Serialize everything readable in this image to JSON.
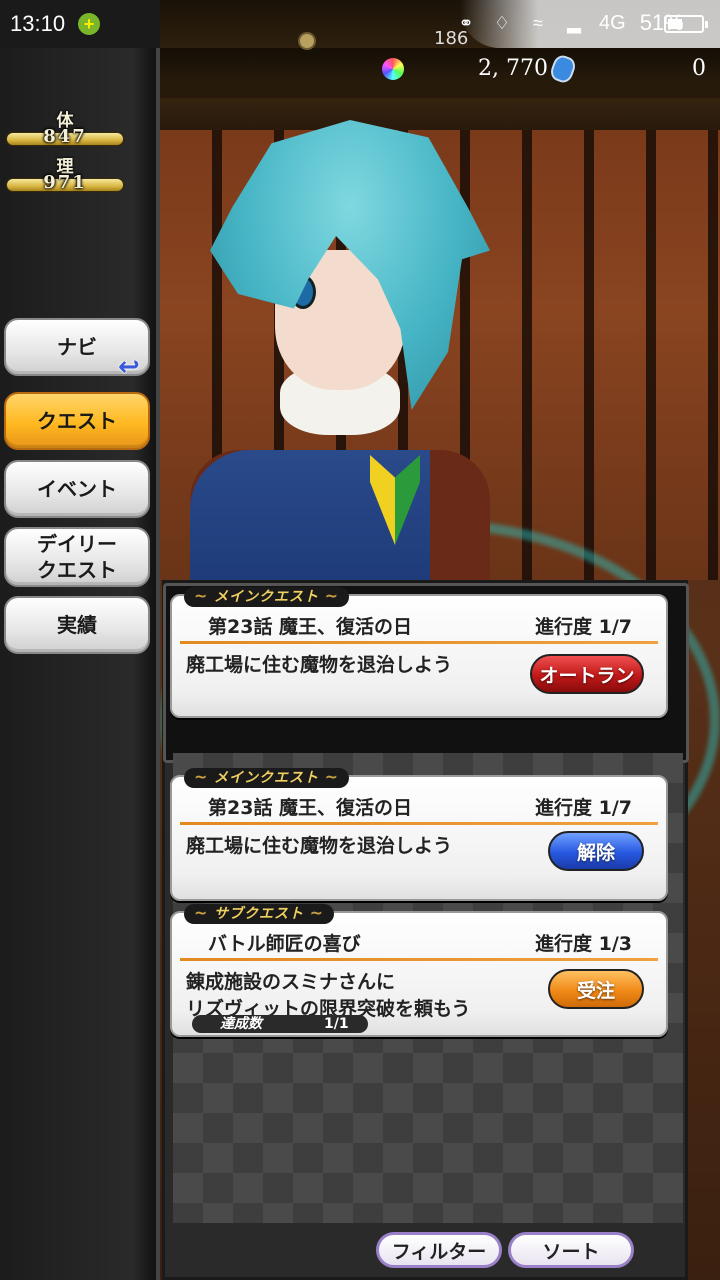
{
  "status_bar": {
    "time": "13:10",
    "network": "4G",
    "battery": "51%"
  },
  "resources": {
    "small_counter": "186",
    "gems": "2, 770",
    "crystals": "0"
  },
  "stats": [
    {
      "label": "体",
      "value": "847"
    },
    {
      "label": "理",
      "value": "971"
    }
  ],
  "nav": {
    "items": [
      {
        "label": "ナビ",
        "active": false
      },
      {
        "label": "クエスト",
        "active": true
      },
      {
        "label": "イベント",
        "active": false
      },
      {
        "label": "デイリー\nクエスト",
        "active": false
      },
      {
        "label": "実績",
        "active": false
      }
    ]
  },
  "quests": [
    {
      "tag": "メインクエスト",
      "title": "第23話  魔王、復活の日",
      "progress": "進行度  1/7",
      "description": "廃工場に住む魔物を退治しよう",
      "button": "オートラン"
    },
    {
      "tag": "メインクエスト",
      "title": "第23話  魔王、復活の日",
      "progress": "進行度  1/7",
      "description": "廃工場に住む魔物を退治しよう",
      "button": "解除"
    },
    {
      "tag": "サブクエスト",
      "title": "バトル師匠の喜び",
      "progress": "進行度  1/3",
      "description_line1": "錬成施設のスミナさんに",
      "description_line2": "リズヴィットの限界突破を頼もう",
      "button": "受注",
      "achievement_label": "達成数",
      "achievement_value": "1/1"
    }
  ],
  "bottom_buttons": {
    "filter": "フィルター",
    "sort": "ソート"
  },
  "colors": {
    "active_tab": "#ffb820",
    "button_red": "#c01818",
    "button_blue": "#2858e0",
    "button_orange": "#f08a18",
    "hair": "#45b4c4"
  }
}
